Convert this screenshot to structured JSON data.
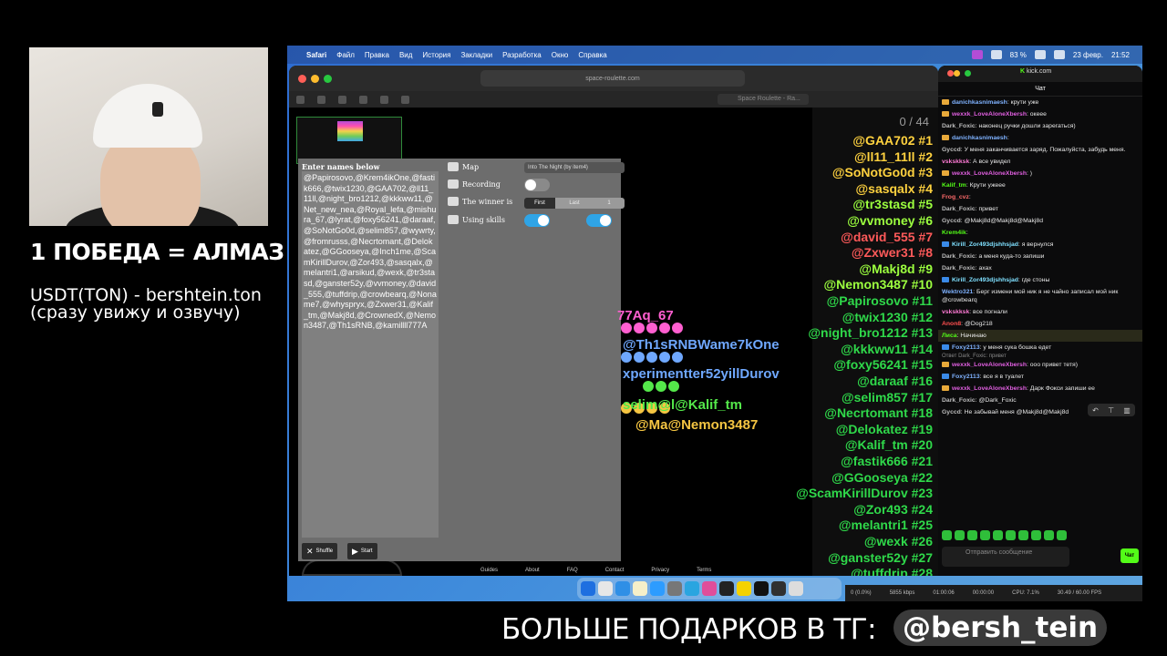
{
  "overlay": {
    "title": "1 ПОБЕДА = АЛМАЗ",
    "line1": "USDT(TON) - bershtein.ton",
    "line2": "(сразу увижу и озвучу)",
    "banner": "БОЛЬШЕ ПОДАРКОВ В ТГ:",
    "handle": "@bersh_tein"
  },
  "menubar": {
    "app": "Safari",
    "items": [
      "Файл",
      "Правка",
      "Вид",
      "История",
      "Закладки",
      "Разработка",
      "Окно",
      "Справка"
    ],
    "battery": "83 %",
    "date": "23 февр.",
    "time": "21:52"
  },
  "safari": {
    "url": "space-roulette.com",
    "tab_title": "Space Roulette - Ra..."
  },
  "game": {
    "names_label": "Enter names below",
    "names_text": "@Papirosovo,@Krem4ikOne,@fastik666,@twix1230,@GAA702,@ll11_11ll,@night_bro1212,@kkkww11,@Net_new_nea,@Royal_lefa,@mishura_67,@lyrat,@foxy56241,@daraaf,@SoNotGo0d,@selim857,@wywrty,@fromrusss,@Necrtomant,@Delokatez,@GGooseya,@Inch1me,@ScamKirillDurov,@Zor493,@sasqalx,@melantri1,@arsikud,@wexk,@tr3stasd,@ganster52y,@vvmoney,@david_555,@tuffdrip,@crowbearq,@Noname7,@whyspryx,@Zxwer31,@Kalif_tm,@Makj8d,@CrownedX,@Nemon3487,@Th1sRNB,@kamillll777A",
    "map_label": "Map",
    "map_value": "Into The Night (by item4)",
    "recording_label": "Recording",
    "winner_label": "The winner is",
    "winner_first": "First",
    "winner_last": "Last",
    "winner_num": "1",
    "skills_label": "Using skills",
    "shuffle": "Shuffle",
    "start": "Start",
    "counter": "0 / 44",
    "footer_links": [
      "Guides",
      "About",
      "FAQ",
      "Contact",
      "Privacy",
      "Terms"
    ],
    "arena_texts": [
      {
        "text": "77Aq_67",
        "color": "#ff5fd0"
      },
      {
        "text": "@Th1sRNBWame7kOne",
        "color": "#6fa8ff"
      },
      {
        "text": "xperimentter52yillDurov",
        "color": "#6fa8ff"
      },
      {
        "text": "selim@l@Kalif_tm",
        "color": "#54e84a"
      },
      {
        "text": "@Ma@Nemon3487",
        "color": "#f5c542"
      }
    ],
    "leaderboard": [
      "@GAA702 #1",
      "@ll11_11ll #2",
      "@SoNotGo0d #3",
      "@sasqalx #4",
      "@tr3stasd #5",
      "@vvmoney #6",
      "@david_555 #7",
      "@Zxwer31 #8",
      "@Makj8d #9",
      "@Nemon3487 #10",
      "@Papirosovo #11",
      "@twix1230 #12",
      "@night_bro1212 #13",
      "@kkkww11 #14",
      "@foxy56241 #15",
      "@daraaf #16",
      "@selim857 #17",
      "@Necrtomant #18",
      "@Delokatez #19",
      "@Kalif_tm #20",
      "@fastik666 #21",
      "@GGooseya #22",
      "@ScamKirillDurov #23",
      "@Zor493 #24",
      "@melantri1 #25",
      "@wexk #26",
      "@ganster52y #27",
      "@tuffdrip #28"
    ],
    "leaderboard_colors": [
      "#ffd23f",
      "#ffd23f",
      "#ffd23f",
      "#ffd23f",
      "#9cff3f",
      "#9cff3f",
      "#ff5a5a",
      "#ff5a5a",
      "#9cff3f",
      "#9cff3f"
    ]
  },
  "chat": {
    "site": "kick.com",
    "title": "Чат",
    "messages": [
      {
        "user": "danichkasnimaesh",
        "color": "#7fb2ff",
        "badge": "#e8a93a",
        "text": "крути уже"
      },
      {
        "user": "wexxk_LoveAloneXbersh",
        "color": "#e05fe0",
        "badge": "#e8a93a",
        "text": "океее"
      },
      {
        "user": "Dark_Foxic",
        "color": "#bdbdbd",
        "badge": "",
        "text": "наконец ручки дошли зарегаться)"
      },
      {
        "user": "danichkasnimaesh",
        "color": "#7fb2ff",
        "badge": "#e8a93a",
        "text": ""
      },
      {
        "user": "Gyccd",
        "color": "#bdbdbd",
        "badge": "",
        "text": "У меня заканчивается заряд. Пожалуйста, забудь меня."
      },
      {
        "user": "vskskksk",
        "color": "#ff7ad6",
        "badge": "",
        "text": "А все увидел"
      },
      {
        "user": "wexxk_LoveAloneXbersh",
        "color": "#e05fe0",
        "badge": "#e8a93a",
        "text": ")"
      },
      {
        "user": "Kalif_tm",
        "color": "#53fc18",
        "badge": "",
        "text": "Крути ужеее"
      },
      {
        "user": "Frog_cvz",
        "color": "#ff6b6b",
        "badge": "",
        "text": ""
      },
      {
        "user": "Dark_Foxic",
        "color": "#bdbdbd",
        "badge": "",
        "text": "привет"
      },
      {
        "user": "Gyccd",
        "color": "#bdbdbd",
        "badge": "",
        "text": "@Makj8d@Makj8d@Makj8d"
      },
      {
        "user": "Krem4ik",
        "color": "#53fc18",
        "badge": "",
        "text": ""
      },
      {
        "user": "Kirill_Zor493djshhsjad",
        "color": "#7fe0ff",
        "badge": "#3a8ae8",
        "text": "я вернулся"
      },
      {
        "user": "Dark_Foxic",
        "color": "#bdbdbd",
        "badge": "",
        "text": "а меня куда-то запиши"
      },
      {
        "user": "Dark_Foxic",
        "color": "#bdbdbd",
        "badge": "",
        "text": "ахах"
      },
      {
        "user": "Kirill_Zor493djshhsjad",
        "color": "#7fe0ff",
        "badge": "#3a8ae8",
        "text": "где стоны"
      },
      {
        "user": "Wektro321",
        "color": "#7fb2ff",
        "badge": "",
        "text": "Берг измени мой ник я не чайно записал мой ник @crowbearq"
      },
      {
        "user": "vskskksk",
        "color": "#ff7ad6",
        "badge": "",
        "text": "все погнали"
      },
      {
        "user": "Anon8",
        "color": "#ff4f4f",
        "badge": "",
        "text": "@Dog218"
      },
      {
        "user": "Лиса",
        "color": "#53fc18",
        "badge": "",
        "text": "Начинаю",
        "hl": true
      },
      {
        "user": "Foxy2113",
        "color": "#7fb2ff",
        "badge": "#3a8ae8",
        "text": "у меня сука бошка едет"
      },
      {
        "user": "wexxk_LoveAloneXbersh",
        "color": "#e05fe0",
        "badge": "#e8a93a",
        "text": "ооо привет тетя)",
        "reply": "Ответ Dark_Foxic: привет"
      },
      {
        "user": "Foxy2113",
        "color": "#7fb2ff",
        "badge": "#3a8ae8",
        "text": "все я в туалет"
      },
      {
        "user": "wexxk_LoveAloneXbersh",
        "color": "#e05fe0",
        "badge": "#e8a93a",
        "text": "Дарк Фокси запиши ее"
      },
      {
        "user": "Dark_Foxic",
        "color": "#bdbdbd",
        "badge": "",
        "text": "@Dark_Foxic"
      },
      {
        "user": "Gyccd",
        "color": "#bdbdbd",
        "badge": "",
        "text": "Не забывай меня @Makj8d@Makj8d"
      }
    ],
    "input_placeholder": "Отправить сообщение",
    "send": "Чат"
  },
  "obs": {
    "dropped": "0 (0.0%)",
    "bitrate": "5855 kbps",
    "time1": "01:00:06",
    "time2": "00:00:00",
    "cpu": "CPU: 7.1%",
    "fps": "30.49 / 60.00 FPS"
  }
}
